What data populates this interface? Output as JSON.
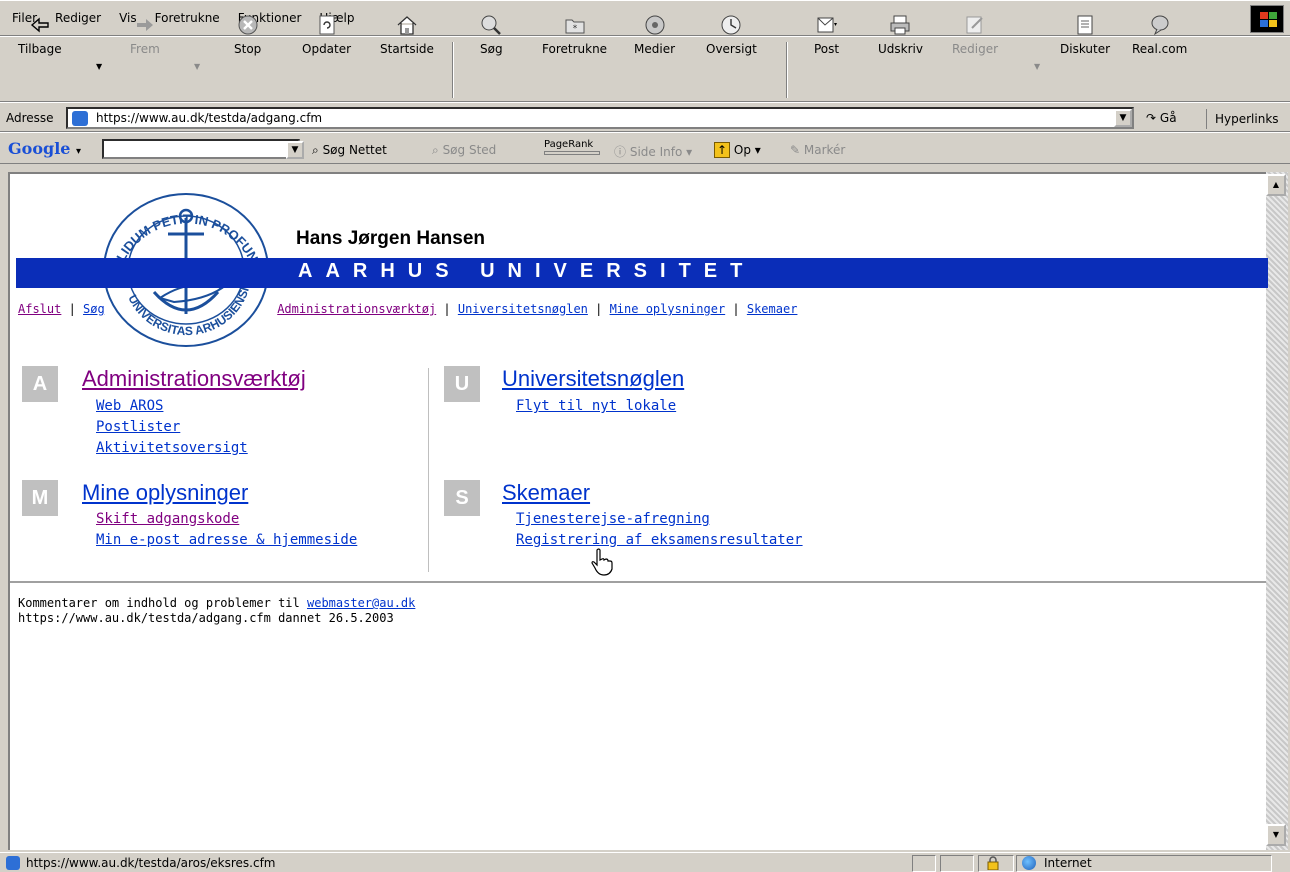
{
  "menu": [
    "Filer",
    "Rediger",
    "Vis",
    "Foretrukne",
    "Funktioner",
    "Hjælp"
  ],
  "toolbar": {
    "back": "Tilbage",
    "forward": "Frem",
    "stop": "Stop",
    "refresh": "Opdater",
    "home": "Startside",
    "search": "Søg",
    "favorites": "Foretrukne",
    "media": "Medier",
    "history": "Oversigt",
    "mail": "Post",
    "print": "Udskriv",
    "edit": "Rediger",
    "discuss": "Diskuter",
    "real": "Real.com"
  },
  "address": {
    "label": "Adresse",
    "url": "https://www.au.dk/testda/adgang.cfm",
    "go": "Gå",
    "links": "Hyperlinks"
  },
  "google": {
    "logo": "Google",
    "search_web": "Søg Nettet",
    "search_site": "Søg Sted",
    "pagerank": "PageRank",
    "page_info": "Side Info",
    "up": "Op",
    "highlight": "Markér"
  },
  "page": {
    "seal_text_top": "SOLIDUM PETIT IN PROFUNDIS",
    "seal_text_bottom": "UNIVERSITAS ARHUSIENSIS",
    "person": "Hans Jørgen Hansen",
    "university": "AARHUS UNIVERSITET",
    "nav": {
      "logout": "Afslut",
      "search": "Søg",
      "admin": "Administrationsværktøj",
      "key": "Universitetsnøglen",
      "info": "Mine oplysninger",
      "forms": "Skemaer"
    },
    "sections": {
      "admin": {
        "letter": "A",
        "title": "Administrationsværktøj",
        "links": [
          "Web AROS",
          "Postlister",
          "Aktivitetsoversigt"
        ]
      },
      "key": {
        "letter": "U",
        "title": "Universitetsnøglen",
        "links": [
          "Flyt til nyt lokale"
        ]
      },
      "info": {
        "letter": "M",
        "title": "Mine oplysninger",
        "links": [
          "Skift adgangskode",
          "Min e-post adresse & hjemmeside"
        ]
      },
      "forms": {
        "letter": "S",
        "title": "Skemaer",
        "links": [
          "Tjenesterejse-afregning",
          "Registrering af eksamensresultater"
        ]
      }
    },
    "footer": {
      "comment": "Kommentarer om indhold og problemer til",
      "email": "webmaster@au.dk",
      "created": "https://www.au.dk/testda/adgang.cfm dannet 26.5.2003"
    }
  },
  "status": {
    "url": "https://www.au.dk/testda/aros/eksres.cfm",
    "zone": "Internet"
  },
  "colors": {
    "au_blue": "#0a2db8",
    "link": "#0033cc",
    "visited": "#800080"
  }
}
